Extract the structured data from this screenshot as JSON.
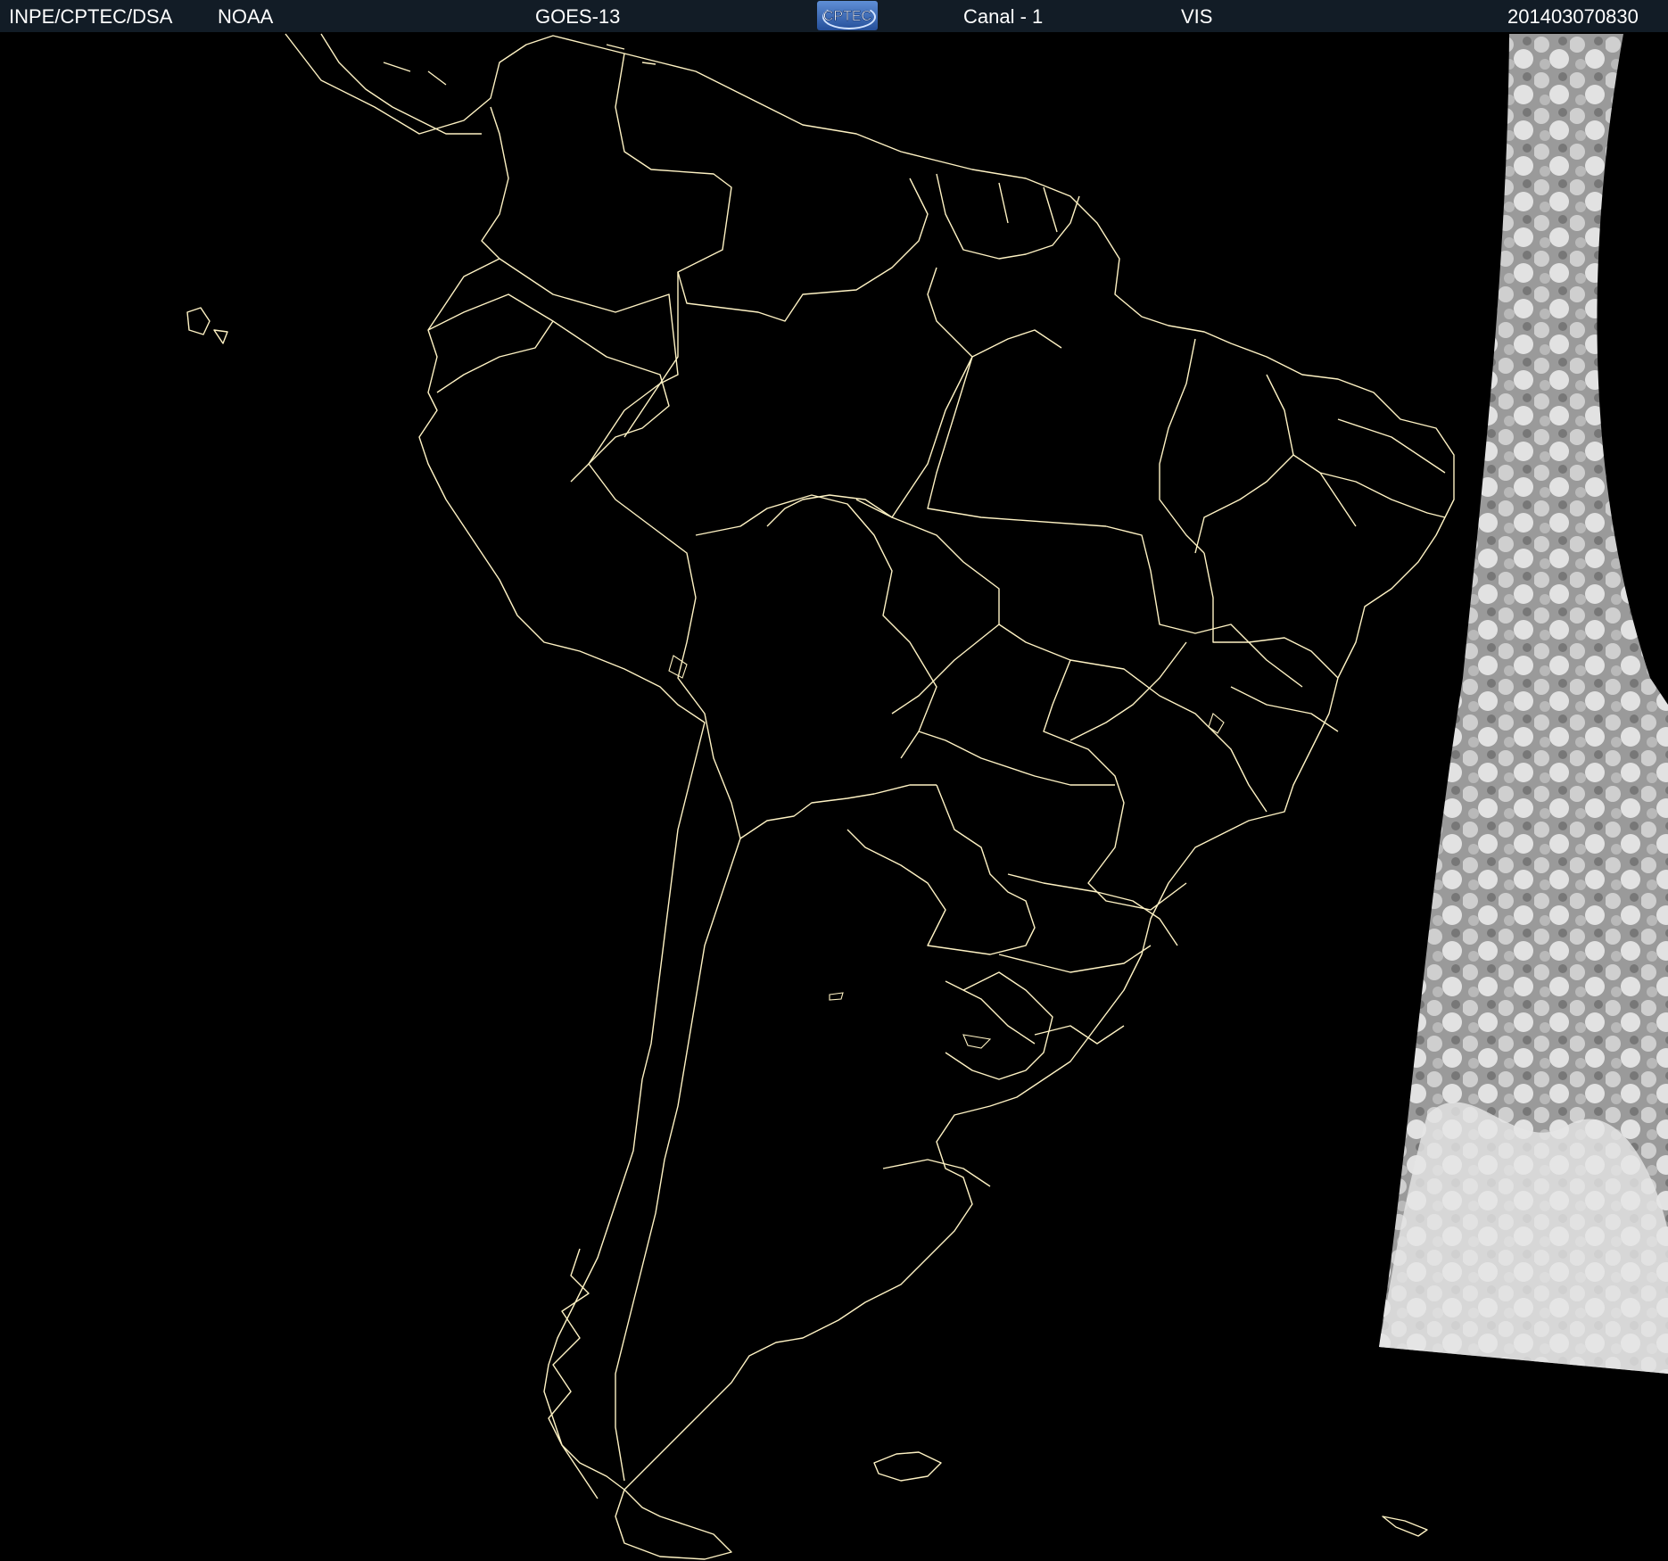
{
  "header": {
    "institution": "INPE/CPTEC/DSA",
    "agency": "NOAA",
    "satellite": "GOES-13",
    "logo_text": "CPTEC",
    "channel": "Canal - 1",
    "band": "VIS",
    "timestamp": "201403070830"
  },
  "map": {
    "region_icon": "south-america-outline",
    "border_color": "#fff3c4",
    "background_color": "#000000",
    "cloud_color": "#c8c8c8"
  }
}
